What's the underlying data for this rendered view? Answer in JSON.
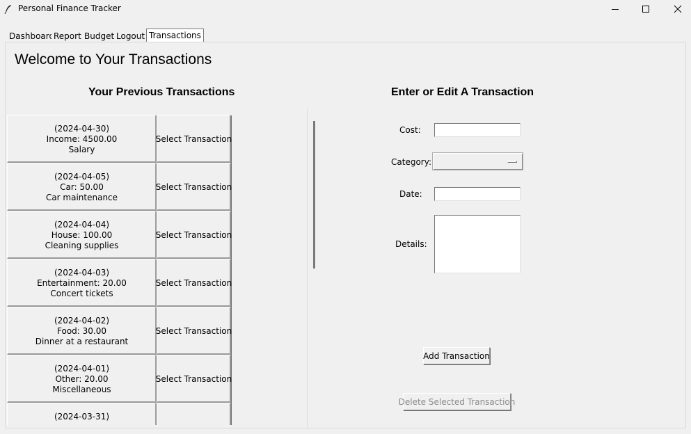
{
  "window": {
    "title": "Personal Finance Tracker",
    "icon": "feather-icon"
  },
  "tabs": [
    {
      "label": "Dashboard",
      "active": false
    },
    {
      "label": "Report",
      "active": false
    },
    {
      "label": "Budget",
      "active": false
    },
    {
      "label": "Logout",
      "active": false
    },
    {
      "label": "Transactions",
      "active": true
    }
  ],
  "page": {
    "title": "Welcome to Your Transactions",
    "list_title": "Your Previous Transactions",
    "form_title": "Enter or Edit A Transaction"
  },
  "transactions": [
    {
      "date": "(2024-04-30)",
      "amount": "Income: 4500.00",
      "details": "Salary",
      "select_label": "Select Transaction"
    },
    {
      "date": "(2024-04-05)",
      "amount": "Car: 50.00",
      "details": "Car maintenance",
      "select_label": "Select Transaction"
    },
    {
      "date": "(2024-04-04)",
      "amount": "House: 100.00",
      "details": "Cleaning supplies",
      "select_label": "Select Transaction"
    },
    {
      "date": "(2024-04-03)",
      "amount": "Entertainment: 20.00",
      "details": "Concert tickets",
      "select_label": "Select Transaction"
    },
    {
      "date": "(2024-04-02)",
      "amount": "Food: 30.00",
      "details": "Dinner at a restaurant",
      "select_label": "Select Transaction"
    },
    {
      "date": "(2024-04-01)",
      "amount": "Other: 20.00",
      "details": "Miscellaneous",
      "select_label": "Select Transaction"
    },
    {
      "date": "(2024-03-31)",
      "amount": "",
      "details": "",
      "select_label": ""
    }
  ],
  "form": {
    "cost_label": "Cost:",
    "cost_value": "",
    "category_label": "Category:",
    "category_value": "",
    "date_label": "Date:",
    "date_value": "",
    "details_label": "Details:",
    "details_value": "",
    "add_button": "Add Transaction",
    "delete_button": "Delete Selected Transaction"
  }
}
